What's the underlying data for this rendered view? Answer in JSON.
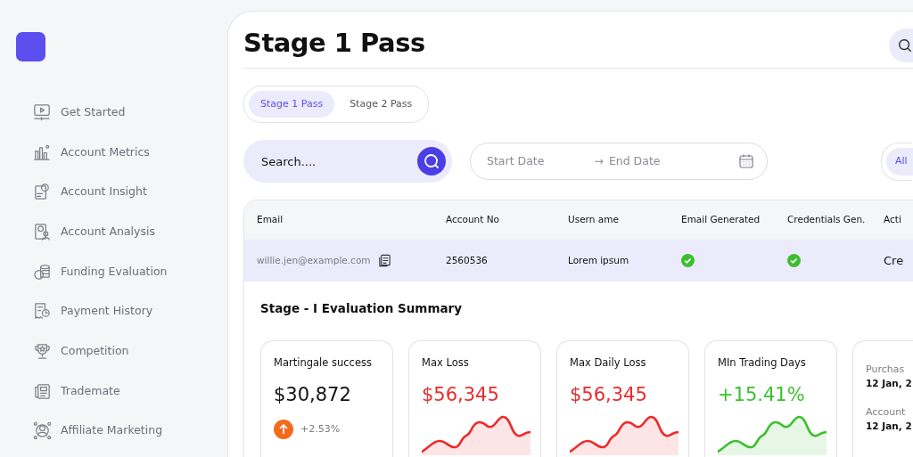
{
  "sidebar": {
    "items": [
      {
        "label": "Get Started"
      },
      {
        "label": "Account Metrics"
      },
      {
        "label": "Account Insight"
      },
      {
        "label": "Account Analysis"
      },
      {
        "label": "Funding Evaluation"
      },
      {
        "label": "Payment History"
      },
      {
        "label": "Competition"
      },
      {
        "label": "Trademate"
      },
      {
        "label": "Affiliate Marketing"
      }
    ]
  },
  "page": {
    "title": "Stage 1 Pass"
  },
  "tabs": [
    {
      "label": "Stage 1 Pass",
      "selected": true
    },
    {
      "label": "Stage 2 Pass",
      "selected": false
    }
  ],
  "search": {
    "placeholder": "Search...."
  },
  "date_range": {
    "start_placeholder": "Start Date",
    "separator": "→",
    "end_placeholder": "End Date"
  },
  "filter": {
    "label": "All",
    "selected": true
  },
  "table": {
    "columns": [
      "Email",
      "Account No",
      "Usern ame",
      "Email Generated",
      "Credentials Gen.",
      "Acti"
    ],
    "rows": [
      {
        "email": "willie.jen@example.com",
        "account_no": "2560536",
        "username": "Lorem ipsum",
        "email_generated": true,
        "credentials_generated": true,
        "action": "Cre"
      }
    ]
  },
  "summary": {
    "title": "Stage - I  Evaluation Summary",
    "cards": [
      {
        "kind": "change",
        "label": "Martingale success",
        "value": "$30,872",
        "change": "+2.53%",
        "color": "#111111"
      },
      {
        "kind": "sparkline",
        "label": "Max Loss",
        "value": "$56,345",
        "color": "#ee2a2a"
      },
      {
        "kind": "sparkline",
        "label": "Max Daily Loss",
        "value": "$56,345",
        "color": "#ee2a2a"
      },
      {
        "kind": "sparkline",
        "label": "MIn Trading Days",
        "value": "+15.41%",
        "color": "#3cbf2e"
      },
      {
        "kind": "dates",
        "fields": [
          {
            "label": "Purchas",
            "value": "12 Jan, 2"
          },
          {
            "label": "Account",
            "value": "12 Jan, 2"
          }
        ]
      }
    ]
  }
}
